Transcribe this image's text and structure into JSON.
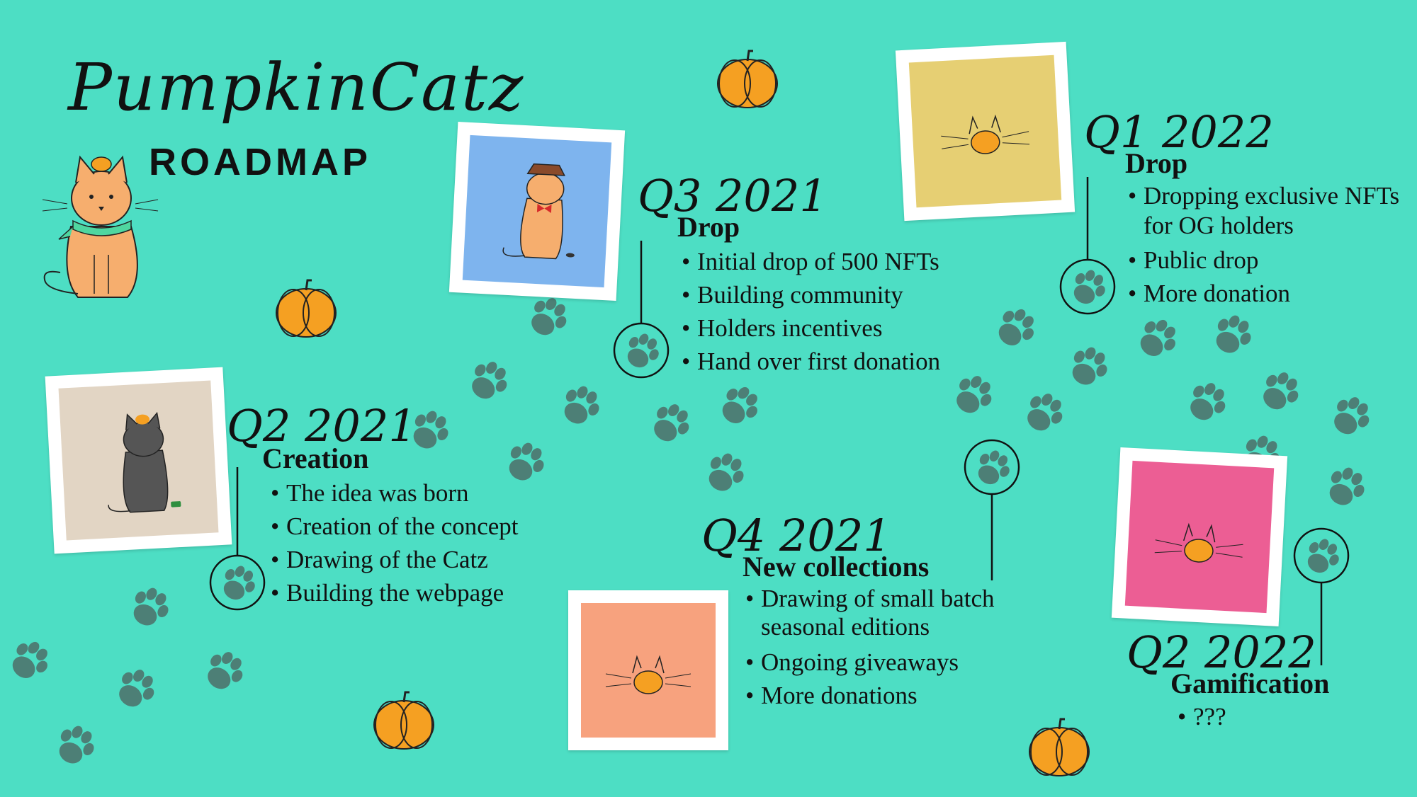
{
  "header": {
    "logo": "PumpkinCatz",
    "subtitle": "ROADMAP"
  },
  "colors": {
    "background": "#4ddec4",
    "paw": "#4d7f76",
    "pumpkin": "#f5a022"
  },
  "milestones": [
    {
      "id": "q2-2021",
      "quarter": "Q2 2021",
      "title": "Creation",
      "items": [
        "The idea was born",
        "Creation of the concept",
        "Drawing of the Catz",
        "Building the webpage"
      ]
    },
    {
      "id": "q3-2021",
      "quarter": "Q3 2021",
      "title": "Drop",
      "items": [
        "Initial drop of 500 NFTs",
        "Building community",
        "Holders incentives",
        "Hand over first donation"
      ]
    },
    {
      "id": "q4-2021",
      "quarter": "Q4 2021",
      "title": "New collections",
      "items": [
        "Drawing of small batch seasonal editions",
        "Ongoing giveaways",
        "More donations"
      ]
    },
    {
      "id": "q1-2022",
      "quarter": "Q1 2022",
      "title": "Drop",
      "items": [
        "Dropping exclusive NFTs for OG holders",
        "Public drop",
        "More donation"
      ]
    },
    {
      "id": "q2-2022",
      "quarter": "Q2 2022",
      "title": "Gamification",
      "items": [
        "???"
      ]
    }
  ],
  "illustrations": [
    {
      "name": "grey-cat-card",
      "bg": "#e2d5c4"
    },
    {
      "name": "hat-cat-card",
      "bg": "#7eb4ee"
    },
    {
      "name": "yellow-pumpkin-card",
      "bg": "#e6cf73"
    },
    {
      "name": "orange-pumpkin-card",
      "bg": "#f7a27e"
    },
    {
      "name": "pink-pumpkin-card",
      "bg": "#ec5e94"
    }
  ]
}
